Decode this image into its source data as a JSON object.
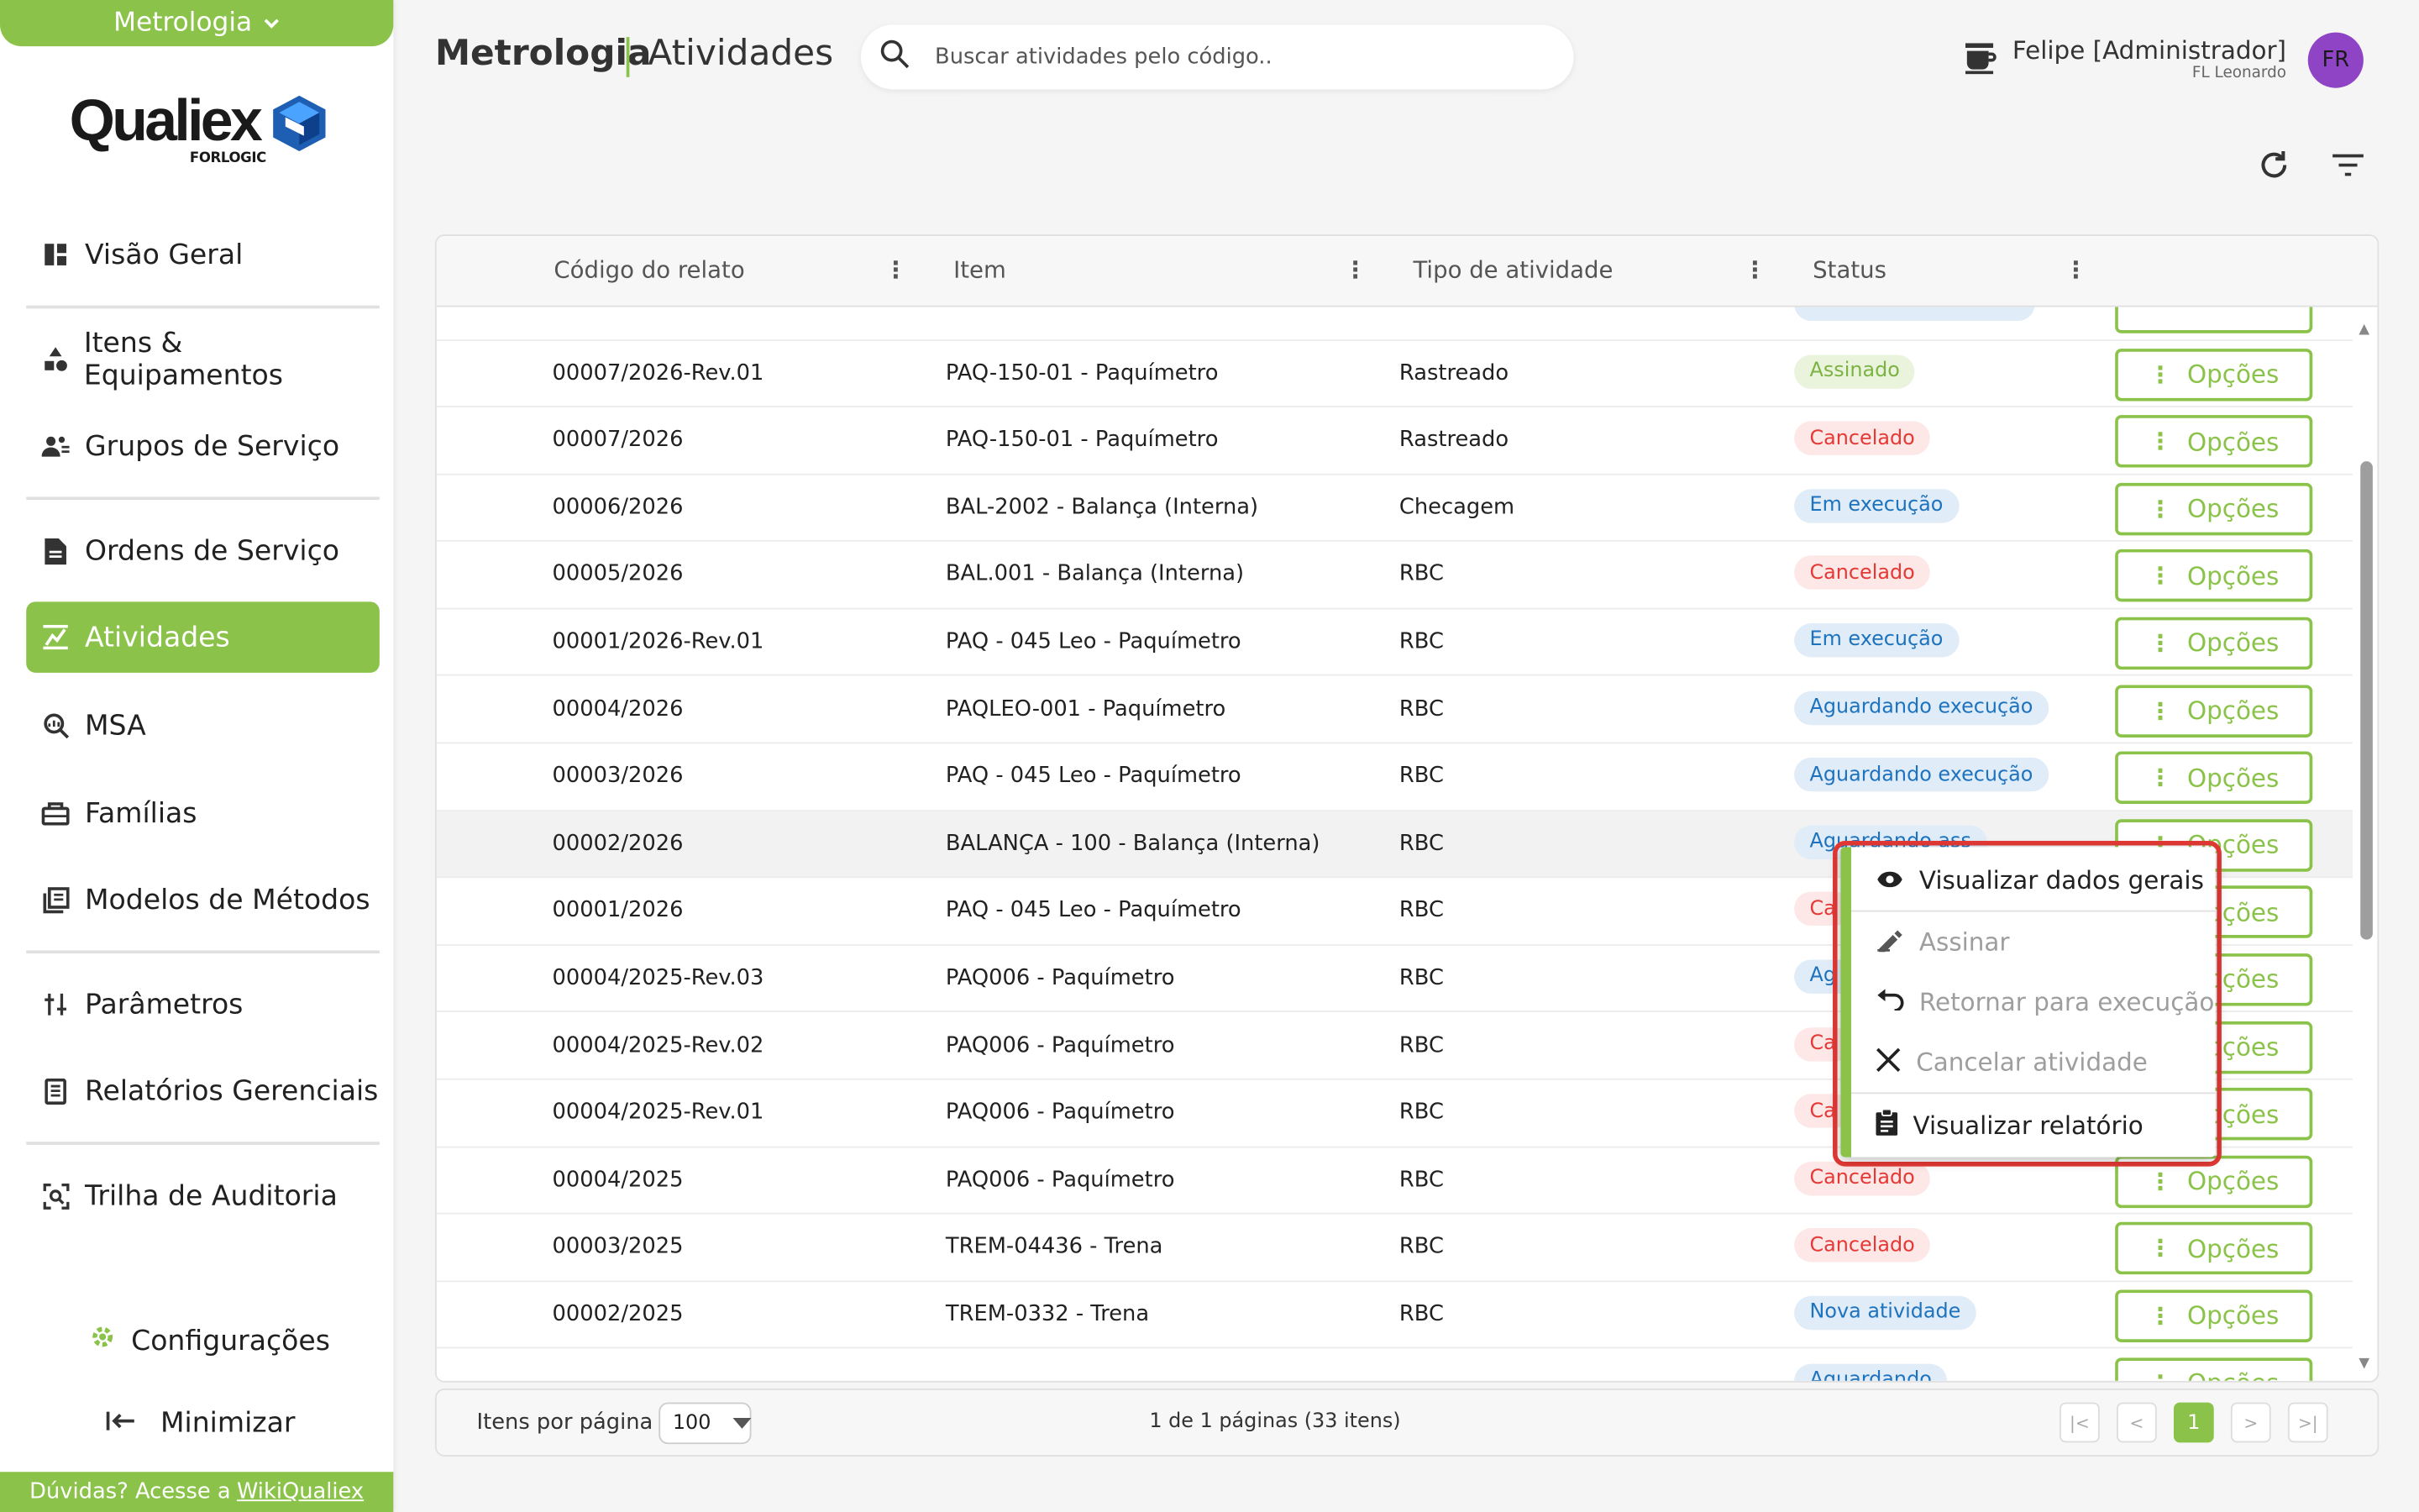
{
  "app": {
    "module": "Metrologia",
    "logo_text": "Qualiex",
    "logo_sub": "FORLOGIC"
  },
  "header": {
    "title": "Metrologia",
    "subtitle": "Atividades",
    "search_placeholder": "Buscar atividades pelo código..",
    "user_name": "Felipe [Administrador]",
    "user_company": "FL Leonardo",
    "avatar_initials": "FR"
  },
  "sidebar": {
    "items": [
      {
        "label": "Visão Geral",
        "icon": "dashboard-icon"
      },
      {
        "label": "Itens & Equipamentos",
        "icon": "shapes-icon"
      },
      {
        "label": "Grupos de Serviço",
        "icon": "group-icon"
      },
      {
        "label": "Ordens de Serviço",
        "icon": "document-icon"
      },
      {
        "label": "Atividades",
        "icon": "activities-icon",
        "active": true
      },
      {
        "label": "MSA",
        "icon": "msa-icon"
      },
      {
        "label": "Famílias",
        "icon": "family-icon"
      },
      {
        "label": "Modelos de Métodos",
        "icon": "methods-icon"
      },
      {
        "label": "Parâmetros",
        "icon": "parameters-icon"
      },
      {
        "label": "Relatórios Gerenciais",
        "icon": "reports-icon"
      },
      {
        "label": "Trilha de Auditoria",
        "icon": "audit-icon"
      }
    ],
    "settings_label": "Configurações",
    "minimize_label": "Minimizar",
    "help_text": "Dúvidas? Acesse a",
    "help_link": "WikiQualiex"
  },
  "table": {
    "columns": [
      "Código do relato",
      "Item",
      "Tipo de atividade",
      "Status"
    ],
    "options_label": "Opções",
    "rows": [
      {
        "code": "00007/2026-Rev.01",
        "item": "PAQ-150-01 - Paquímetro",
        "type": "Rastreado",
        "status": "Assinado",
        "status_color": "green"
      },
      {
        "code": "00007/2026",
        "item": "PAQ-150-01 - Paquímetro",
        "type": "Rastreado",
        "status": "Cancelado",
        "status_color": "red"
      },
      {
        "code": "00006/2026",
        "item": "BAL-2002 - Balança (Interna)",
        "type": "Checagem",
        "status": "Em execução",
        "status_color": "blue"
      },
      {
        "code": "00005/2026",
        "item": "BAL.001 - Balança (Interna)",
        "type": "RBC",
        "status": "Cancelado",
        "status_color": "red"
      },
      {
        "code": "00001/2026-Rev.01",
        "item": "PAQ - 045 Leo - Paquímetro",
        "type": "RBC",
        "status": "Em execução",
        "status_color": "blue"
      },
      {
        "code": "00004/2026",
        "item": "PAQLEO-001 - Paquímetro",
        "type": "RBC",
        "status": "Aguardando execução",
        "status_color": "blue"
      },
      {
        "code": "00003/2026",
        "item": "PAQ - 045 Leo - Paquímetro",
        "type": "RBC",
        "status": "Aguardando execução",
        "status_color": "blue"
      },
      {
        "code": "00002/2026",
        "item": "BALANÇA - 100 - Balança (Interna)",
        "type": "RBC",
        "status": "Aguardando ass",
        "status_color": "blue"
      },
      {
        "code": "00001/2026",
        "item": "PAQ - 045 Leo - Paquímetro",
        "type": "RBC",
        "status": "Ca",
        "status_color": "red"
      },
      {
        "code": "00004/2025-Rev.03",
        "item": "PAQ006 - Paquímetro",
        "type": "RBC",
        "status": "Ag ass",
        "status_color": "blue"
      },
      {
        "code": "00004/2025-Rev.02",
        "item": "PAQ006 - Paquímetro",
        "type": "RBC",
        "status": "Ca",
        "status_color": "red"
      },
      {
        "code": "00004/2025-Rev.01",
        "item": "PAQ006 - Paquímetro",
        "type": "RBC",
        "status": "Ca",
        "status_color": "red"
      },
      {
        "code": "00004/2025",
        "item": "PAQ006 - Paquímetro",
        "type": "RBC",
        "status": "Cancelado",
        "status_color": "red"
      },
      {
        "code": "00003/2025",
        "item": "TREM-04436 - Trena",
        "type": "RBC",
        "status": "Cancelado",
        "status_color": "red"
      },
      {
        "code": "00002/2025",
        "item": "TREM-0332 - Trena",
        "type": "RBC",
        "status": "Nova atividade",
        "status_color": "blue"
      },
      {
        "code": "",
        "item": "",
        "type": "",
        "status": "Aguardando",
        "status_color": "blue"
      }
    ]
  },
  "pagination": {
    "items_per_page_label": "Itens por página",
    "items_per_page": "100",
    "info": "1 de 1 páginas (33 itens)",
    "current_page": "1"
  },
  "context_menu": {
    "items": [
      {
        "label": "Visualizar dados gerais",
        "icon": "eye-icon",
        "disabled": false
      },
      {
        "label": "Assinar",
        "icon": "signature-icon",
        "disabled": true
      },
      {
        "label": "Retornar para execução",
        "icon": "undo-icon",
        "disabled": true
      },
      {
        "label": "Cancelar atividade",
        "icon": "close-icon",
        "disabled": true
      },
      {
        "label": "Visualizar relatório",
        "icon": "clipboard-icon",
        "disabled": false
      }
    ]
  },
  "colors": {
    "accent": "#8bc34a",
    "highlight_outline": "#e53935",
    "badge_green": "#7cb342",
    "badge_red": "#e53935",
    "badge_blue": "#1e73be"
  }
}
